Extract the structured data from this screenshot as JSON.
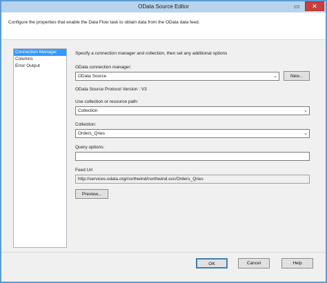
{
  "window": {
    "title": "OData Source Editor",
    "minimize_icon": "minimize-icon",
    "maximize_icon": "maximize-icon",
    "close_icon": "close-icon"
  },
  "description": "Configure the properties that enable the Data Flow task to obtain data from the OData data feed.",
  "nav": {
    "items": [
      {
        "label": "Connection Manager",
        "selected": true
      },
      {
        "label": "Columns",
        "selected": false
      },
      {
        "label": "Error Output",
        "selected": false
      }
    ]
  },
  "panel": {
    "intro": "Specify a connection manager and collection, then set any additional options",
    "connection_label": "OData connection manager:",
    "connection_value": "OData Source",
    "new_button": "New...",
    "protocol_version": "OData Source Protocol Version : V3",
    "use_label": "Use collection or resource path:",
    "use_value": "Collection",
    "collection_label": "Collection:",
    "collection_value": "Orders_Qries",
    "query_label": "Query options:",
    "query_value": "",
    "feed_label": "Feed Url",
    "feed_value": "http://services.odata.org/northwind/northwind.svc/Orders_Qries",
    "preview_button": "Preview..."
  },
  "footer": {
    "ok": "OK",
    "cancel": "Cancel",
    "help": "Help"
  }
}
